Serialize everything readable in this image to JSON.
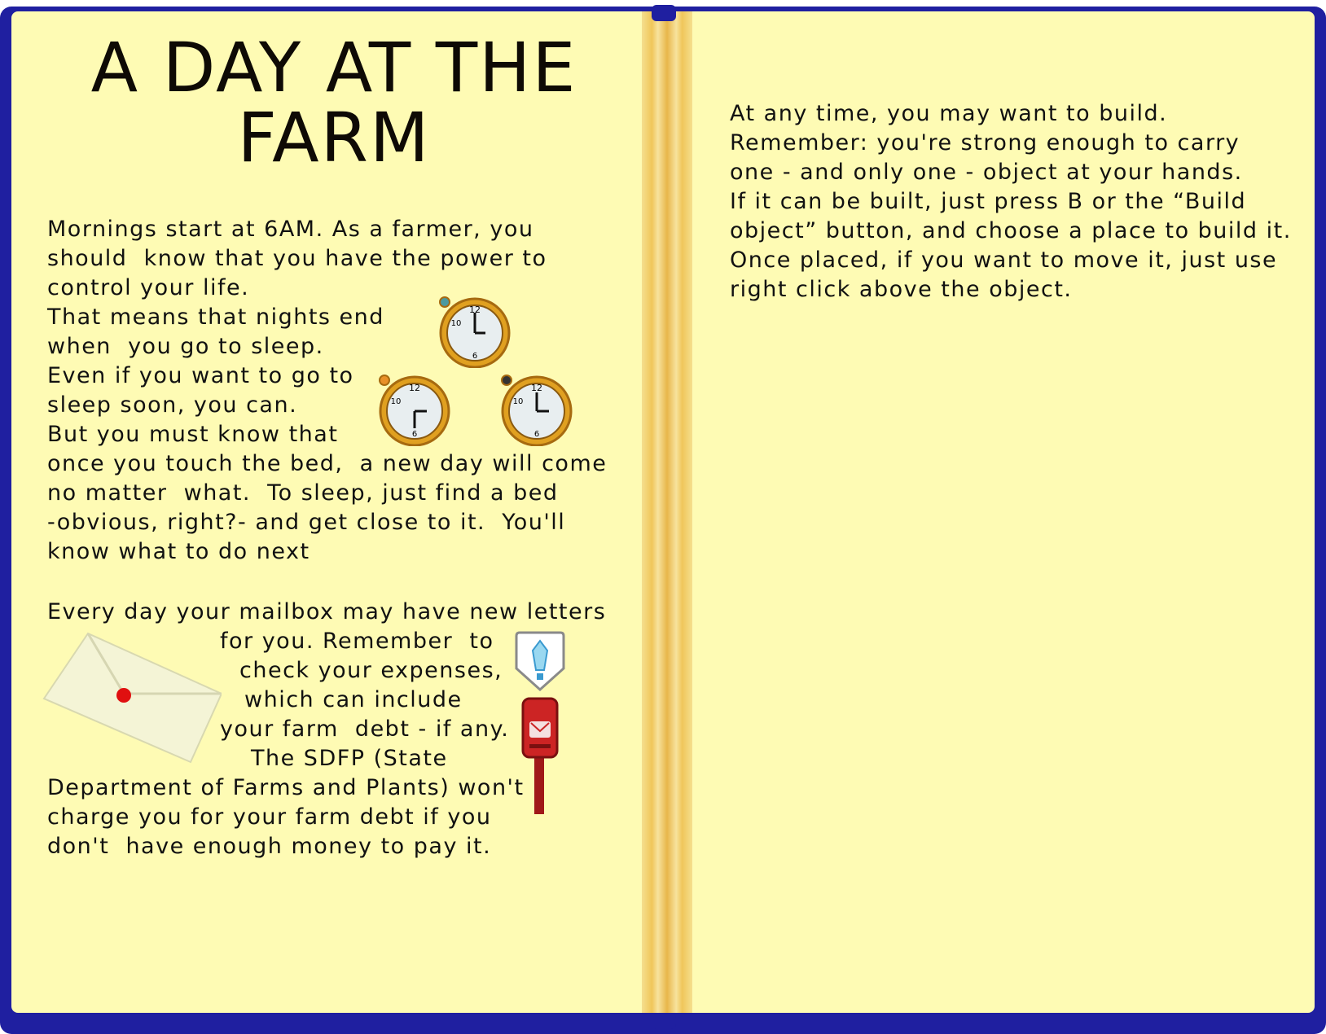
{
  "book": {
    "colors": {
      "cover": "#1f1fa0",
      "page": "#fefbb4",
      "spine": "#f0c65a"
    }
  },
  "left_page": {
    "title_line1": "A DAY AT THE",
    "title_line2": "FARM",
    "paragraph1": [
      "Mornings start at 6AM. As a farmer, you",
      "should  know that you have the power to",
      "control your life.",
      "That means that nights end",
      "when  you go to sleep.",
      "Even if you want to go to",
      "sleep soon, you can.",
      "But you must know that",
      "once you touch the bed,  a new day will come",
      "no matter  what.  To sleep, just find a bed",
      "-obvious, right?- and get close to it.  You'll",
      "know what to do next"
    ],
    "paragraph2": [
      "Every day your mailbox may have new letters",
      "for you. Remember  to",
      "check your expenses,",
      "which can include",
      "your farm  debt - if any.",
      "The SDFP (State",
      "Department of Farms and Plants) won't",
      "charge you for your farm debt if you",
      "don't  have enough money to pay it."
    ],
    "icons": [
      "clock-icon",
      "clock-icon",
      "clock-icon",
      "envelope-icon",
      "gem-bubble-icon",
      "mailbox-icon"
    ]
  },
  "right_page": {
    "paragraph": [
      "At any time, you may want to build.",
      "Remember: you're strong enough to carry",
      "one - and only one - object at your hands.",
      "If it can be built, just press B or the “Build",
      "object” button, and choose a place to build it.",
      "Once placed, if you want to move it, just use",
      "right click above the object."
    ]
  }
}
